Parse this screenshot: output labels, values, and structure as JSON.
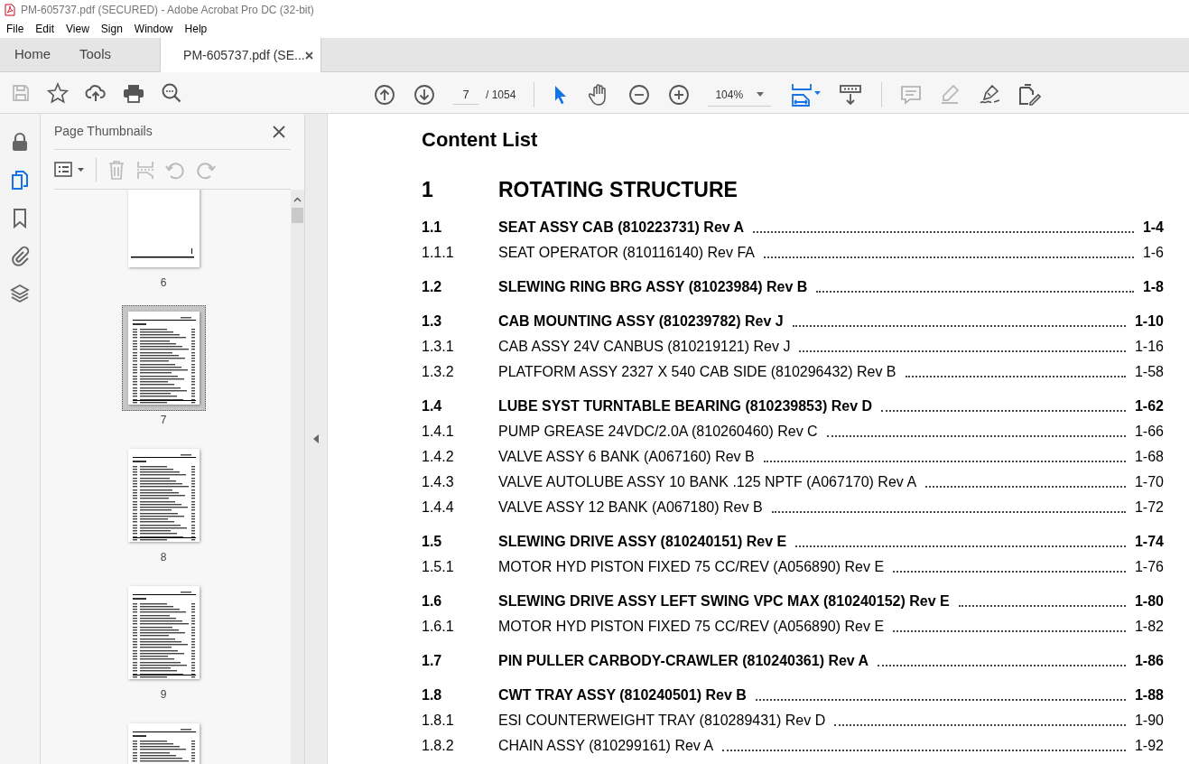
{
  "window": {
    "title": "PM-605737.pdf (SECURED) - Adobe Acrobat Pro DC (32-bit)"
  },
  "menu": [
    "File",
    "Edit",
    "View",
    "Sign",
    "Window",
    "Help"
  ],
  "tabs": [
    {
      "label": "Home",
      "selected": false,
      "closable": false
    },
    {
      "label": "Tools",
      "selected": false,
      "closable": false
    },
    {
      "label": "PM-605737.pdf (SE...",
      "selected": true,
      "closable": true
    }
  ],
  "toolbar": {
    "page_field": "7",
    "page_total": "/ 1054",
    "zoom": "104%"
  },
  "rail": [
    {
      "kind": "lock",
      "selected": false
    },
    {
      "kind": "pages",
      "selected": true
    },
    {
      "kind": "bookmark",
      "selected": false
    },
    {
      "kind": "attachment",
      "selected": false
    },
    {
      "kind": "layers",
      "selected": false
    }
  ],
  "panel": {
    "title": "Page Thumbnails",
    "thumbnails": [
      {
        "kind": "blank",
        "label": "6",
        "selected": false
      },
      {
        "kind": "text",
        "label": "7",
        "selected": true
      },
      {
        "kind": "text",
        "label": "8",
        "selected": false
      },
      {
        "kind": "text",
        "label": "9",
        "selected": false
      },
      {
        "kind": "text",
        "selected": false
      }
    ]
  },
  "document": {
    "heading": "Content List",
    "chapter": {
      "number": "1",
      "title": "ROTATING STRUCTURE"
    },
    "entries": [
      {
        "number": "1.1",
        "title": "SEAT ASSY CAB (810223731) Rev A",
        "page": "1-4",
        "children": [
          {
            "number": "1.1.1",
            "title": "SEAT OPERATOR (810116140) Rev FA",
            "page": "1-6"
          }
        ]
      },
      {
        "number": "1.2",
        "title": "SLEWING RING BRG ASSY (81023984) Rev B",
        "page": "1-8"
      },
      {
        "number": "1.3",
        "title": "CAB MOUNTING ASSY (810239782) Rev J",
        "page": "1-10",
        "children": [
          {
            "number": "1.3.1",
            "title": "CAB ASSY 24V CANBUS (810219121) Rev J",
            "page": "1-16"
          },
          {
            "number": "1.3.2",
            "title": "PLATFORM ASSY 2327 X 540 CAB SIDE (810296432) Rev B",
            "page": "1-58"
          }
        ]
      },
      {
        "number": "1.4",
        "title": "LUBE SYST TURNTABLE BEARING (810239853) Rev D",
        "page": "1-62",
        "children": [
          {
            "number": "1.4.1",
            "title": "PUMP GREASE 24VDC/2.0A (810260460) Rev C",
            "page": "1-66"
          },
          {
            "number": "1.4.2",
            "title": "VALVE ASSY 6 BANK (A067160) Rev B",
            "page": "1-68"
          },
          {
            "number": "1.4.3",
            "title": "VALVE AUTOLUBE ASSY 10 BANK .125 NPTF (A067170) Rev A",
            "page": "1-70"
          },
          {
            "number": "1.4.4",
            "title": "VALVE ASSY 12 BANK (A067180) Rev B",
            "page": "1-72"
          }
        ]
      },
      {
        "number": "1.5",
        "title": "SLEWING DRIVE ASSY (810240151) Rev E",
        "page": "1-74",
        "children": [
          {
            "number": "1.5.1",
            "title": "MOTOR HYD PISTON FIXED 75 CC/REV (A056890) Rev E",
            "page": "1-76"
          }
        ]
      },
      {
        "number": "1.6",
        "title": "SLEWING DRIVE ASSY LEFT SWING VPC MAX (810240152) Rev E",
        "page": "1-80",
        "children": [
          {
            "number": "1.6.1",
            "title": "MOTOR HYD PISTON FIXED 75 CC/REV (A056890) Rev E",
            "page": "1-82"
          }
        ]
      },
      {
        "number": "1.7",
        "title": "PIN PULLER CARBODY-CRAWLER (810240361) Rev A",
        "page": "1-86"
      },
      {
        "number": "1.8",
        "title": "CWT TRAY ASSY (810240501) Rev B",
        "page": "1-88",
        "children": [
          {
            "number": "1.8.1",
            "title": "ESI COUNTERWEIGHT TRAY (810289431) Rev D",
            "page": "1-90"
          },
          {
            "number": "1.8.2",
            "title": "CHAIN ASSY (810299161) Rev A",
            "page": "1-92"
          }
        ]
      }
    ]
  }
}
